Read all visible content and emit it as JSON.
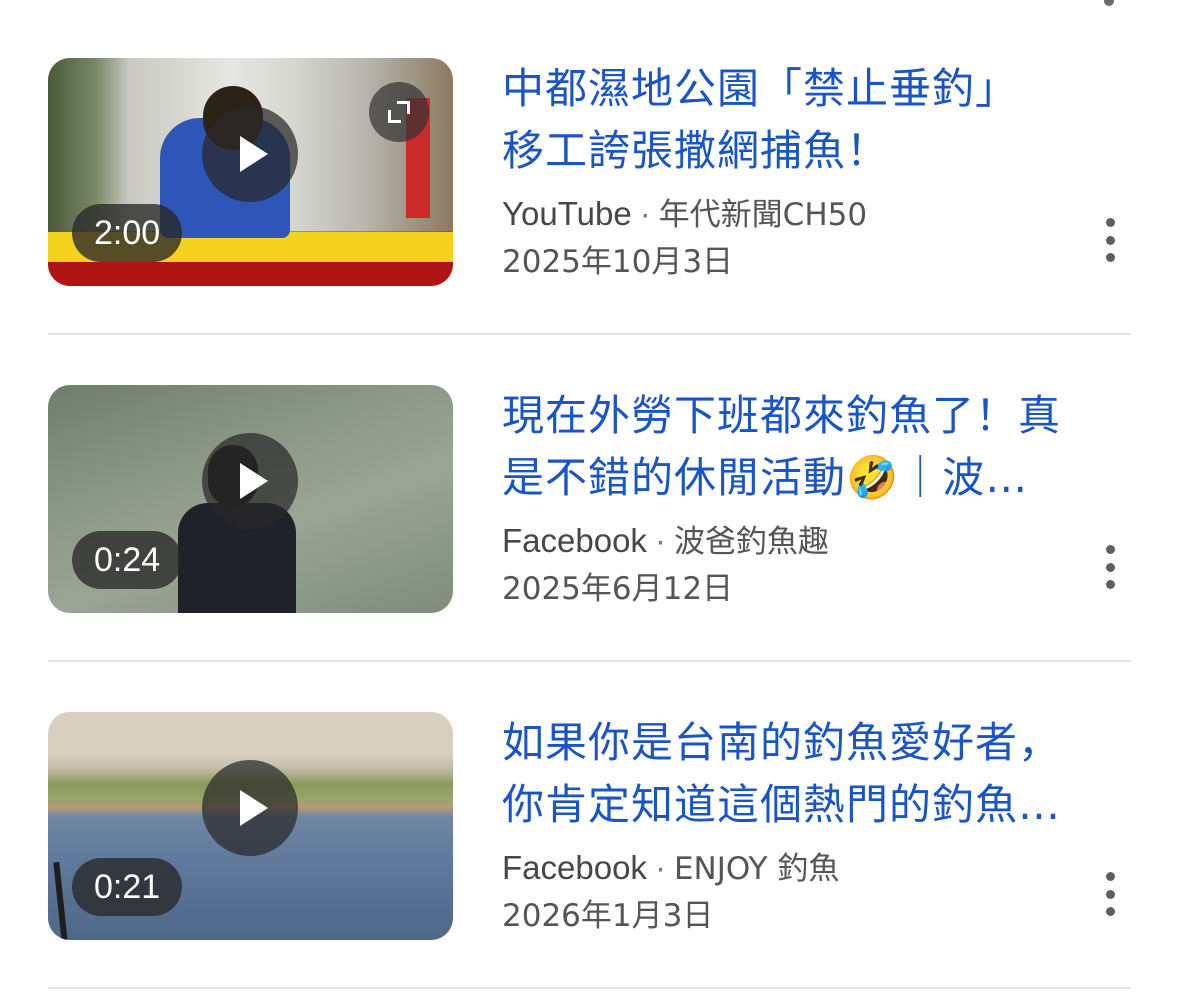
{
  "results": [
    {
      "title_lines": [
        "中都濕地公園「禁止垂釣」",
        "移工誇張撒網捕魚！"
      ],
      "source": "YouTube",
      "separator": "·",
      "channel": "年代新聞CH50",
      "date": "2025年10月3日",
      "duration": "2:00",
      "has_expand": true
    },
    {
      "title_lines": [
        "現在外勞下班都來釣魚了！真",
        "是不錯的休閒活動🤣｜波…"
      ],
      "source": "Facebook",
      "separator": "·",
      "channel": "波爸釣魚趣",
      "date": "2025年6月12日",
      "duration": "0:24",
      "has_expand": false
    },
    {
      "title_lines": [
        "如果你是台南的釣魚愛好者，",
        "你肯定知道這個熱門的釣魚…"
      ],
      "source": "Facebook",
      "separator": "·",
      "channel": "ENJOY 釣魚",
      "date": "2026年1月3日",
      "duration": "0:21",
      "has_expand": false
    }
  ],
  "colors": {
    "title": "#1a55c6",
    "meta": "#474747",
    "divider": "#e3e3e3"
  },
  "icons": {
    "play": "play-icon",
    "expand": "expand-icon",
    "more": "more-vert-icon"
  }
}
